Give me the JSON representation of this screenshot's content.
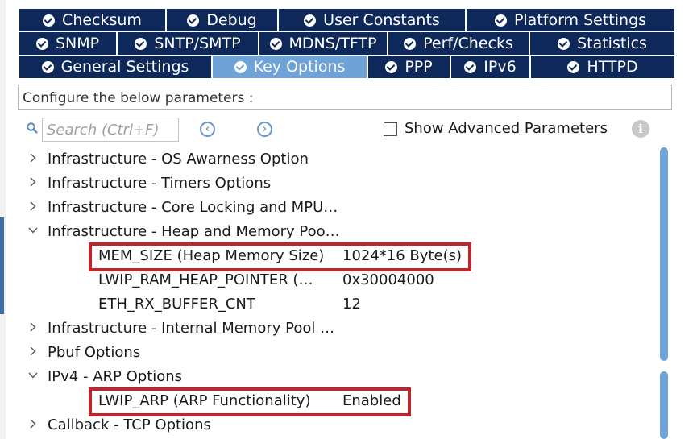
{
  "tabs": {
    "row1": [
      "Checksum",
      "Debug",
      "User Constants",
      "Platform Settings"
    ],
    "row2": [
      "SNMP",
      "SNTP/SMTP",
      "MDNS/TFTP",
      "Perf/Checks",
      "Statistics"
    ],
    "row3": [
      "General Settings",
      "Key Options",
      "PPP",
      "IPv6",
      "HTTPD"
    ],
    "active": "Key Options",
    "icon": "check-circle-icon"
  },
  "config_caption": "Configure the below parameters :",
  "toolbar": {
    "search_placeholder": "Search (Ctrl+F)",
    "search_value": "",
    "prev_icon": "chevron-left-circle-icon",
    "next_icon": "chevron-right-circle-icon",
    "show_advanced_label": "Show Advanced Parameters",
    "show_advanced_checked": false,
    "info_icon": "info-icon"
  },
  "tree": {
    "items": [
      {
        "type": "group",
        "label": "Infrastructure - OS Awarness Option",
        "expanded": false
      },
      {
        "type": "group",
        "label": "Infrastructure - Timers Options",
        "expanded": false
      },
      {
        "type": "group",
        "label": "Infrastructure - Core Locking and MPU…",
        "expanded": false
      },
      {
        "type": "group",
        "label": "Infrastructure - Heap and Memory Poo…",
        "expanded": true
      },
      {
        "type": "param",
        "name": "MEM_SIZE (Heap Memory Size)",
        "value": "1024*16 Byte(s)",
        "highlighted": true
      },
      {
        "type": "param",
        "name": "LWIP_RAM_HEAP_POINTER (…",
        "value": "0x30004000",
        "highlighted": false
      },
      {
        "type": "param",
        "name": "ETH_RX_BUFFER_CNT",
        "value": "12",
        "highlighted": false
      },
      {
        "type": "group",
        "label": "Infrastructure - Internal Memory Pool …",
        "expanded": false
      },
      {
        "type": "group",
        "label": "Pbuf Options",
        "expanded": false
      },
      {
        "type": "group",
        "label": "IPv4 - ARP Options",
        "expanded": true
      },
      {
        "type": "param",
        "name": "LWIP_ARP (ARP Functionality)",
        "value": "Enabled",
        "highlighted": true
      },
      {
        "type": "group",
        "label": "Callback - TCP Options",
        "expanded": false
      }
    ]
  },
  "colors": {
    "tab_bg": "#0d2859",
    "tab_active_bg": "#6fa3d8",
    "highlight_border": "#c0252c",
    "scrollbar": "#6fa3d8"
  }
}
